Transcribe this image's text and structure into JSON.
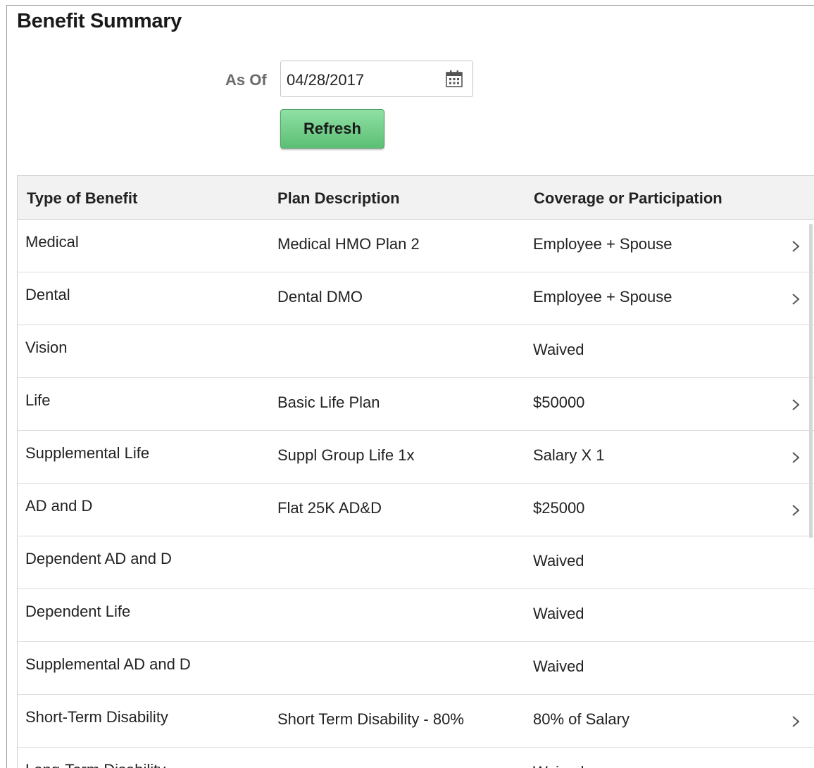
{
  "page": {
    "title": "Benefit Summary"
  },
  "filters": {
    "as_of_label": "As Of",
    "as_of_value": "04/28/2017",
    "refresh_label": "Refresh"
  },
  "table": {
    "headers": [
      "Type of Benefit",
      "Plan Description",
      "Coverage or Participation"
    ],
    "rows": [
      {
        "type": "Medical",
        "plan": "Medical HMO Plan 2",
        "coverage": "Employee + Spouse",
        "has_detail": true
      },
      {
        "type": "Dental",
        "plan": "Dental DMO",
        "coverage": "Employee + Spouse",
        "has_detail": true
      },
      {
        "type": "Vision",
        "plan": "",
        "coverage": "Waived",
        "has_detail": false
      },
      {
        "type": "Life",
        "plan": "Basic Life Plan",
        "coverage": "$50000",
        "has_detail": true
      },
      {
        "type": "Supplemental Life",
        "plan": "Suppl Group Life 1x",
        "coverage": "Salary X 1",
        "has_detail": true
      },
      {
        "type": "AD and D",
        "plan": "Flat 25K AD&D",
        "coverage": "$25000",
        "has_detail": true
      },
      {
        "type": "Dependent AD and D",
        "plan": "",
        "coverage": "Waived",
        "has_detail": false
      },
      {
        "type": "Dependent Life",
        "plan": "",
        "coverage": "Waived",
        "has_detail": false
      },
      {
        "type": "Supplemental AD and D",
        "plan": "",
        "coverage": "Waived",
        "has_detail": false
      },
      {
        "type": "Short-Term Disability",
        "plan": "Short Term Disability - 80%",
        "coverage": "80% of Salary",
        "has_detail": true
      },
      {
        "type": "Long-Term Disability",
        "plan": "",
        "coverage": "Waived",
        "has_detail": false
      }
    ]
  },
  "icons": {
    "date_picker": "calendar-icon",
    "row_detail": "chevron-right-icon"
  },
  "colors": {
    "refresh_button": "#6ccb84",
    "header_bg": "#f2f2f2"
  }
}
